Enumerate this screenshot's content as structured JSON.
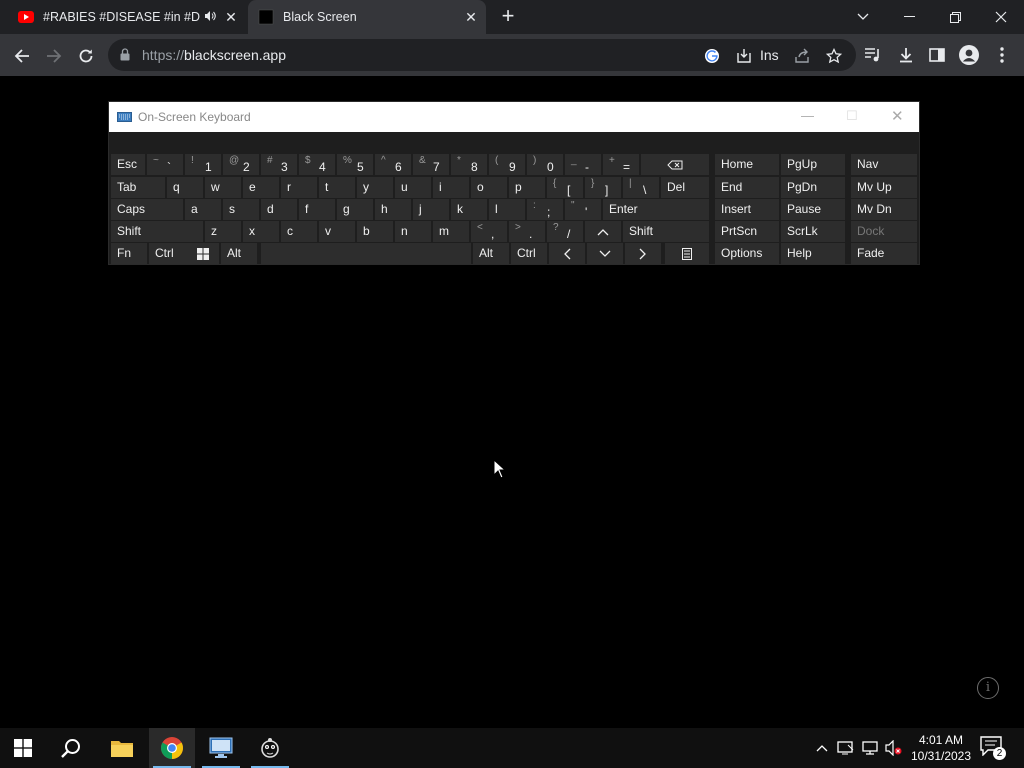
{
  "browser": {
    "tabs": [
      {
        "title": "#RABIES #DISEASE #in #DOG",
        "favicon": "youtube-icon",
        "audio": true,
        "active": false
      },
      {
        "title": "Black Screen",
        "favicon": "black-square-icon",
        "active": true
      }
    ],
    "url_scheme": "https://",
    "url_host": "blackscreen.app",
    "install_label": "Ins"
  },
  "osk": {
    "title": "On-Screen Keyboard",
    "rows": {
      "r1": [
        {
          "k": "esc",
          "label": "Esc"
        },
        {
          "k": "tilde",
          "shift": "~",
          "main": "`"
        },
        {
          "k": "1",
          "shift": "!",
          "main": "1"
        },
        {
          "k": "2",
          "shift": "@",
          "main": "2"
        },
        {
          "k": "3",
          "shift": "#",
          "main": "3"
        },
        {
          "k": "4",
          "shift": "$",
          "main": "4"
        },
        {
          "k": "5",
          "shift": "%",
          "main": "5"
        },
        {
          "k": "6",
          "shift": "^",
          "main": "6"
        },
        {
          "k": "7",
          "shift": "&",
          "main": "7"
        },
        {
          "k": "8",
          "shift": "*",
          "main": "8"
        },
        {
          "k": "9",
          "shift": "(",
          "main": "9"
        },
        {
          "k": "0",
          "shift": ")",
          "main": "0"
        },
        {
          "k": "minus",
          "shift": "_",
          "main": "-"
        },
        {
          "k": "equals",
          "shift": "+",
          "main": "="
        }
      ],
      "r2": [
        {
          "k": "tab",
          "label": "Tab"
        },
        {
          "k": "q",
          "label": "q"
        },
        {
          "k": "w",
          "label": "w"
        },
        {
          "k": "e",
          "label": "e"
        },
        {
          "k": "r",
          "label": "r"
        },
        {
          "k": "t",
          "label": "t"
        },
        {
          "k": "y",
          "label": "y"
        },
        {
          "k": "u",
          "label": "u"
        },
        {
          "k": "i",
          "label": "i"
        },
        {
          "k": "o",
          "label": "o"
        },
        {
          "k": "p",
          "label": "p"
        },
        {
          "k": "lbracket",
          "shift": "{",
          "main": "["
        },
        {
          "k": "rbracket",
          "shift": "}",
          "main": "]"
        },
        {
          "k": "backslash",
          "shift": "|",
          "main": "\\"
        },
        {
          "k": "del",
          "label": "Del"
        }
      ],
      "r3": [
        {
          "k": "caps",
          "label": "Caps"
        },
        {
          "k": "a",
          "label": "a"
        },
        {
          "k": "s",
          "label": "s"
        },
        {
          "k": "d",
          "label": "d"
        },
        {
          "k": "f",
          "label": "f"
        },
        {
          "k": "g",
          "label": "g"
        },
        {
          "k": "h",
          "label": "h"
        },
        {
          "k": "j",
          "label": "j"
        },
        {
          "k": "k",
          "label": "k"
        },
        {
          "k": "l",
          "label": "l"
        },
        {
          "k": "semicolon",
          "shift": ":",
          "main": ";"
        },
        {
          "k": "quote",
          "shift": "\"",
          "main": "'"
        },
        {
          "k": "enter",
          "label": "Enter"
        }
      ],
      "r4": [
        {
          "k": "lshift",
          "label": "Shift"
        },
        {
          "k": "z",
          "label": "z"
        },
        {
          "k": "x",
          "label": "x"
        },
        {
          "k": "c",
          "label": "c"
        },
        {
          "k": "v",
          "label": "v"
        },
        {
          "k": "b",
          "label": "b"
        },
        {
          "k": "n",
          "label": "n"
        },
        {
          "k": "m",
          "label": "m"
        },
        {
          "k": "comma",
          "shift": "<",
          "main": ","
        },
        {
          "k": "period",
          "shift": ">",
          "main": "."
        },
        {
          "k": "slash",
          "shift": "?",
          "main": "/"
        },
        {
          "k": "rshift",
          "label": "Shift"
        }
      ],
      "r5": [
        {
          "k": "fn",
          "label": "Fn"
        },
        {
          "k": "lctrl",
          "label": "Ctrl"
        },
        {
          "k": "lalt",
          "label": "Alt"
        },
        {
          "k": "ralt",
          "label": "Alt"
        },
        {
          "k": "rctrl",
          "label": "Ctrl"
        }
      ]
    },
    "nav": [
      {
        "k": "home",
        "label": "Home"
      },
      {
        "k": "pgup",
        "label": "PgUp"
      },
      {
        "k": "navk",
        "label": "Nav"
      },
      {
        "k": "end",
        "label": "End"
      },
      {
        "k": "pgdn",
        "label": "PgDn"
      },
      {
        "k": "mvup",
        "label": "Mv Up"
      },
      {
        "k": "insert",
        "label": "Insert"
      },
      {
        "k": "pause",
        "label": "Pause"
      },
      {
        "k": "mvdn",
        "label": "Mv Dn"
      },
      {
        "k": "prtscn",
        "label": "PrtScn"
      },
      {
        "k": "scrlk",
        "label": "ScrLk"
      },
      {
        "k": "dock",
        "label": "Dock"
      },
      {
        "k": "options",
        "label": "Options"
      },
      {
        "k": "help",
        "label": "Help"
      },
      {
        "k": "fade",
        "label": "Fade"
      }
    ]
  },
  "taskbar": {
    "time": "4:01 AM",
    "date": "10/31/2023",
    "notification_count": "2"
  }
}
